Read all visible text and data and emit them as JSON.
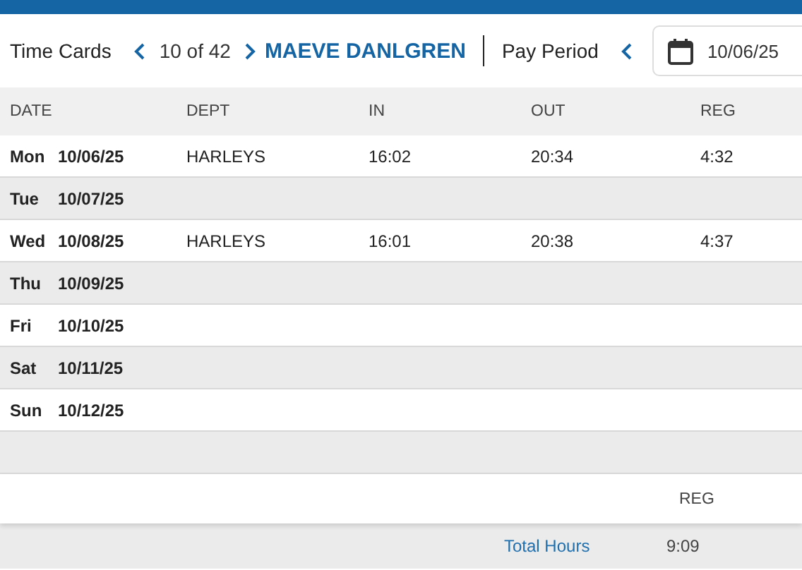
{
  "toolbar": {
    "title": "Time Cards",
    "counter": "10 of 42",
    "employee": "MAEVE DANLGREN",
    "period_label": "Pay Period",
    "date": "10/06/25"
  },
  "table": {
    "columns": [
      "DATE",
      "DEPT",
      "IN",
      "OUT",
      "REG"
    ],
    "rows": [
      {
        "day": "Mon",
        "date": "10/06/25",
        "dept": "HARLEYS",
        "in": "16:02",
        "out": "20:34",
        "reg": "4:32"
      },
      {
        "day": "Tue",
        "date": "10/07/25"
      },
      {
        "day": "Wed",
        "date": "10/08/25",
        "dept": "HARLEYS",
        "in": "16:01",
        "out": "20:38",
        "reg": "4:37"
      },
      {
        "day": "Thu",
        "date": "10/09/25"
      },
      {
        "day": "Fri",
        "date": "10/10/25"
      },
      {
        "day": "Sat",
        "date": "10/11/25"
      },
      {
        "day": "Sun",
        "date": "10/12/25"
      }
    ]
  },
  "summary": {
    "column": "REG",
    "label": "Total Hours",
    "value": "9:09"
  }
}
